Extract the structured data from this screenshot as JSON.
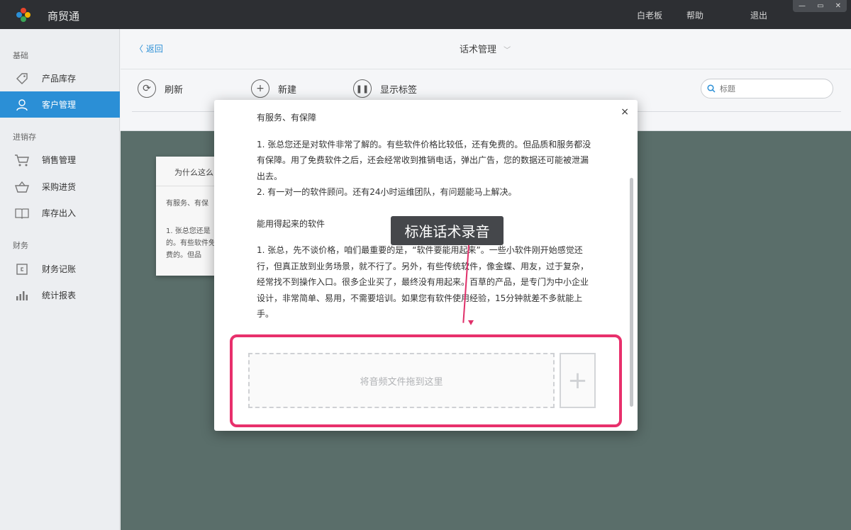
{
  "app": {
    "title": "商贸通",
    "top_links": [
      "白老板",
      "帮助",
      "退出"
    ],
    "window_controls": [
      "—",
      "▭",
      "✕"
    ]
  },
  "sidebar": {
    "groups": [
      {
        "label": "基础",
        "items": [
          {
            "label": "产品库存",
            "icon": "tag-icon"
          },
          {
            "label": "客户管理",
            "icon": "user-icon",
            "active": true
          }
        ]
      },
      {
        "label": "进销存",
        "items": [
          {
            "label": "销售管理",
            "icon": "cart-icon"
          },
          {
            "label": "采购进货",
            "icon": "basket-icon"
          },
          {
            "label": "库存出入",
            "icon": "book-icon"
          }
        ]
      },
      {
        "label": "财务",
        "items": [
          {
            "label": "财务记账",
            "icon": "wallet-icon"
          },
          {
            "label": "统计报表",
            "icon": "bar-chart-icon"
          }
        ]
      }
    ]
  },
  "header": {
    "back_label": "返回",
    "page_title": "话术管理",
    "toolbar": {
      "refresh": "刷新",
      "new": "新建",
      "show_tags": "显示标签"
    },
    "search_placeholder": "标题"
  },
  "bg_card": {
    "title": "为什么这么",
    "line1": "有服务、有保",
    "line2": "1. 张总您还是的。有些软件免费的。但品"
  },
  "modal": {
    "close": "×",
    "heading1": "有服务、有保障",
    "para1": "1. 张总您还是对软件非常了解的。有些软件价格比较低，还有免费的。但品质和服务都没有保障。用了免费软件之后，还会经常收到推销电话，弹出广告，您的数据还可能被泄漏出去。",
    "para2": "2. 有一对一的软件顾问。还有24小时运维团队，有问题能马上解决。",
    "heading2": "能用得起来的软件",
    "para3": "1. 张总，先不谈价格，咱们最重要的是，“软件要能用起来”。一些小软件刚开始感觉还行，但真正放到业务场景，就不行了。另外，有些传统软件，像金蝶、用友，过于复杂，经常找不到操作入口。很多企业买了，最终没有用起来。百草的产品，是专门为中小企业设计，非常简单、易用，不需要培训。如果您有软件使用经验，15分钟就差不多就能上手。",
    "callout": "标准话术录音",
    "dropzone_text": "将音频文件拖到这里",
    "add_symbol": "+"
  },
  "colors": {
    "titlebar": "#2d2f33",
    "accent": "#2b8fd6",
    "highlight": "#e8306c",
    "overlay": "#5a6e6a"
  }
}
